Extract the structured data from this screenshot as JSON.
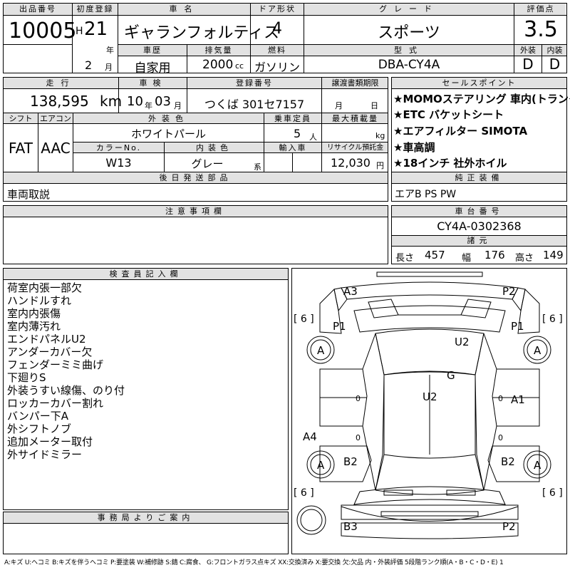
{
  "header": {
    "lot_no_label": "出品番号",
    "lot_no": "10005",
    "first_reg_label": "初度登録",
    "era": "H",
    "year": "21",
    "year_unit": "年",
    "month": "2",
    "month_unit": "月",
    "model_label": "車名",
    "model": "ギャランフォルティス",
    "doors_label": "ドア形状",
    "doors": "4",
    "grade_label": "グレード",
    "grade": "スポーツ",
    "score_label": "評価点",
    "score": "3.5",
    "history_label": "車歴",
    "history": "自家用",
    "displacement_label": "排気量",
    "displacement": "2000",
    "displacement_unit": "cc",
    "fuel_label": "燃料",
    "fuel": "ガソリン",
    "type_label": "型式",
    "type": "DBA-CY4A",
    "exterior_label": "外装",
    "exterior": "D",
    "interior_label": "内装",
    "interior": "D"
  },
  "row2": {
    "mileage_label": "走行",
    "mileage": "138,595",
    "mileage_unit": "km",
    "inspection_label": "車検",
    "insp_year": "10",
    "insp_year_unit": "年",
    "insp_month": "03",
    "insp_month_unit": "月",
    "plate_label": "登録番号",
    "plate": "つくば 301セ7157",
    "transfer_label": "譲渡書類期限",
    "transfer_month_unit": "月",
    "transfer_day_unit": "日"
  },
  "row3": {
    "shift_label": "シフト",
    "shift": "FAT",
    "ac_label": "エアコン",
    "ac": "AAC",
    "ext_color_label": "外装色",
    "ext_color": "ホワイトパール",
    "capacity_label": "乗車定員",
    "capacity": "5",
    "capacity_unit": "人",
    "load_label": "最大積載量",
    "load_unit": "kg",
    "color_no_label": "カラーNo.",
    "color_no": "W13",
    "int_color_label": "内装色",
    "int_color": "グレー",
    "int_color_unit": "系",
    "import_label": "輸入車",
    "recycle_label": "リサイクル預託金",
    "recycle": "12,030",
    "recycle_unit": "円"
  },
  "sales_points": {
    "label": "セールスポイント",
    "items": [
      "★MOMOステアリング 車内(トランク)",
      "★ETC バケットシート",
      "★エアフィルター SIMOTA",
      "★車高調",
      "★18インチ 社外ホイル"
    ]
  },
  "parts": {
    "label": "後日発送部品",
    "value": "車両取説"
  },
  "equipment": {
    "label": "純正装備",
    "value": "エアB PS PW"
  },
  "notes": {
    "label": "注意事項欄"
  },
  "chassis": {
    "label": "車台番号",
    "value": "CY4A-0302368",
    "spec_label": "諸元",
    "length_label": "長さ",
    "length": "457",
    "width_label": "幅",
    "width": "176",
    "height_label": "高さ",
    "height": "149"
  },
  "inspector": {
    "label": "検査員記入欄",
    "lines": [
      "荷室内張一部欠",
      "ハンドルすれ",
      "室内内張傷",
      "室内薄汚れ",
      "エンドパネルU2",
      "アンダーカバー欠",
      "フェンダーミミ曲げ",
      "下廻りS",
      "外装うすい線傷、のり付",
      "ロッカーカバー割れ",
      "バンパー下A",
      "外シフトノブ",
      "追加メーター取付",
      "外サイドミラー"
    ]
  },
  "office": {
    "label": "事務局よりご案内"
  },
  "diagram": {
    "marks": [
      "A3",
      "P2",
      "P1",
      "U2",
      "P1",
      "A",
      "A",
      "G",
      "U2",
      "A1",
      "A4",
      "B2",
      "B2",
      "A",
      "A",
      "B3",
      "P2"
    ],
    "tire_left_top": "[ 6 ]",
    "tire_right_top": "[ 6 ]",
    "tire_left_bottom": "[ 6 ]",
    "tire_right_bottom": "[ 6 ]",
    "zero": "0"
  },
  "legend": "A:キズ U:ヘコミ B:キズを伴うヘコミ P:要塗装 W:補修跡 S:錆 C:腐食、 G:フロントガラス点キズ XX:交換済み X:要交換 欠:欠品 内・外装評価 5段階ランク順(A・B・C・D・E) 1"
}
